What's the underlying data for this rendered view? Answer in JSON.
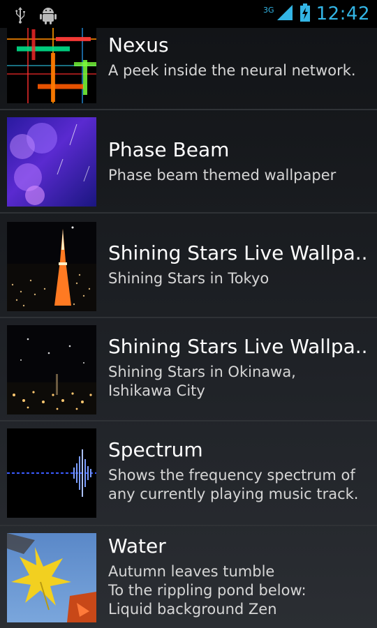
{
  "status_bar": {
    "left_icons": [
      "usb-icon",
      "android-debug-icon"
    ],
    "network": "3G",
    "right_icons": [
      "signal-icon",
      "battery-charging-icon"
    ],
    "time": "12:42"
  },
  "wallpapers": [
    {
      "title": "Nexus",
      "description": "A peek inside the neural network."
    },
    {
      "title": "Phase Beam",
      "description": "Phase beam themed wallpaper"
    },
    {
      "title": "Shining Stars Live Wallpa..",
      "description": "Shining Stars in Tokyo"
    },
    {
      "title": "Shining Stars Live Wallpa..",
      "description": "Shining Stars in Okinawa,\nIshikawa City"
    },
    {
      "title": "Spectrum",
      "description": "Shows the frequency spectrum of any currently playing music track."
    },
    {
      "title": "Water",
      "description": "Autumn leaves tumble\nTo the rippling pond below:\nLiquid background Zen"
    }
  ],
  "colors": {
    "accent": "#33b5e5",
    "divider": "#2f3236"
  }
}
